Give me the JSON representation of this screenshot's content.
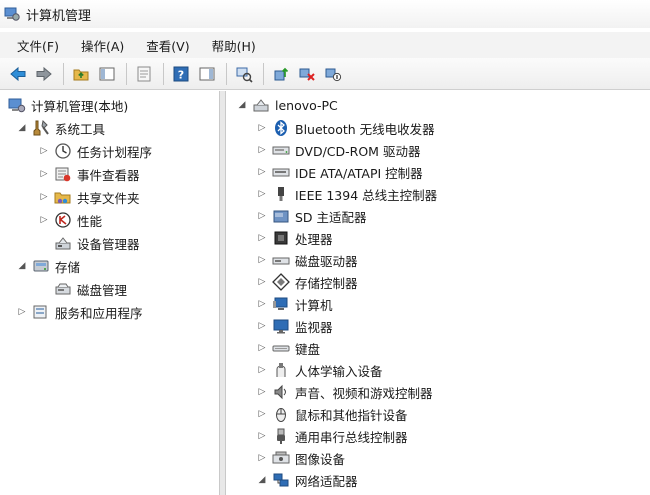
{
  "window": {
    "title": "计算机管理"
  },
  "menu": [
    {
      "label": "文件(F)"
    },
    {
      "label": "操作(A)"
    },
    {
      "label": "查看(V)"
    },
    {
      "label": "帮助(H)"
    }
  ],
  "toolbar": {
    "buttons": [
      {
        "icon": "back-arrow-icon"
      },
      {
        "icon": "forward-arrow-icon"
      },
      {
        "icon": "up-folder-icon"
      },
      {
        "icon": "show-hide-tree-icon"
      },
      {
        "icon": "properties-icon"
      },
      {
        "icon": "help-icon"
      },
      {
        "icon": "show-hide-action-pane-icon"
      },
      {
        "icon": "scan-hardware-icon"
      },
      {
        "icon": "update-driver-icon"
      },
      {
        "icon": "uninstall-device-icon"
      },
      {
        "icon": "disable-device-icon"
      }
    ]
  },
  "left_tree": [
    {
      "label": "计算机管理(本地)",
      "level": 0,
      "expanded": "none",
      "icon": "computer-management-icon"
    },
    {
      "label": "系统工具",
      "level": 1,
      "expanded": "open",
      "icon": "system-tools-icon"
    },
    {
      "label": "任务计划程序",
      "level": 2,
      "expanded": "closed",
      "icon": "task-scheduler-icon"
    },
    {
      "label": "事件查看器",
      "level": 2,
      "expanded": "closed",
      "icon": "event-viewer-icon"
    },
    {
      "label": "共享文件夹",
      "level": 2,
      "expanded": "closed",
      "icon": "shared-folders-icon"
    },
    {
      "label": "性能",
      "level": 2,
      "expanded": "closed",
      "icon": "performance-icon"
    },
    {
      "label": "设备管理器",
      "level": 2,
      "expanded": "none",
      "icon": "device-manager-icon"
    },
    {
      "label": "存储",
      "level": 1,
      "expanded": "open",
      "icon": "storage-icon"
    },
    {
      "label": "磁盘管理",
      "level": 2,
      "expanded": "none",
      "icon": "disk-management-icon"
    },
    {
      "label": "服务和应用程序",
      "level": 1,
      "expanded": "closed",
      "icon": "services-applications-icon"
    }
  ],
  "device_tree": {
    "root": {
      "label": "lenovo-PC",
      "icon": "computer-icon"
    },
    "categories": [
      {
        "label": "Bluetooth 无线电收发器",
        "icon": "bluetooth-icon"
      },
      {
        "label": "DVD/CD-ROM 驱动器",
        "icon": "dvd-drive-icon"
      },
      {
        "label": "IDE ATA/ATAPI 控制器",
        "icon": "ide-controller-icon"
      },
      {
        "label": "IEEE 1394 总线主控制器",
        "icon": "ieee1394-icon"
      },
      {
        "label": "SD 主适配器",
        "icon": "sd-adapter-icon"
      },
      {
        "label": "处理器",
        "icon": "processor-icon"
      },
      {
        "label": "磁盘驱动器",
        "icon": "disk-drive-icon"
      },
      {
        "label": "存储控制器",
        "icon": "storage-controller-icon"
      },
      {
        "label": "计算机",
        "icon": "computer-icon"
      },
      {
        "label": "监视器",
        "icon": "monitor-icon"
      },
      {
        "label": "键盘",
        "icon": "keyboard-icon"
      },
      {
        "label": "人体学输入设备",
        "icon": "hid-icon"
      },
      {
        "label": "声音、视频和游戏控制器",
        "icon": "sound-icon"
      },
      {
        "label": "鼠标和其他指针设备",
        "icon": "mouse-icon"
      },
      {
        "label": "通用串行总线控制器",
        "icon": "usb-icon"
      },
      {
        "label": "图像设备",
        "icon": "imaging-device-icon"
      },
      {
        "label": "网络适配器",
        "icon": "network-adapter-icon"
      }
    ]
  },
  "colors": {
    "accent": "#2f6db5",
    "folder": "#e6b84a"
  }
}
